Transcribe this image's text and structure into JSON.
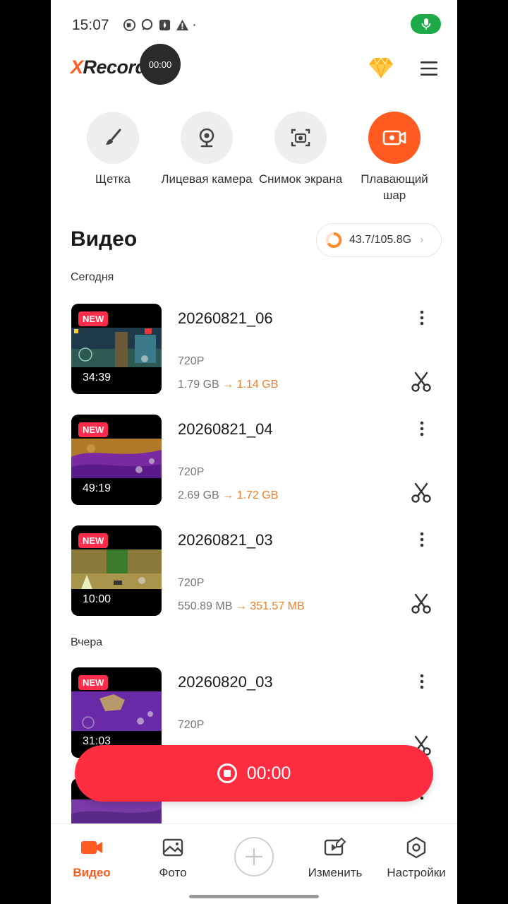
{
  "status": {
    "time": "15:07"
  },
  "header": {
    "logo_x": "X",
    "logo_rest": "Recorder",
    "timer": "00:00"
  },
  "tools": [
    {
      "label": "Щетка",
      "icon": "brush-icon"
    },
    {
      "label": "Лицевая камера",
      "icon": "webcam-icon"
    },
    {
      "label": "Снимок экрана",
      "icon": "screenshot-icon"
    },
    {
      "label": "Плавающий шар",
      "icon": "floating-ball-icon"
    }
  ],
  "videos": {
    "title": "Видео",
    "storage": "43.7/105.8G",
    "groups": [
      {
        "label": "Сегодня"
      },
      {
        "label": "Вчера"
      }
    ],
    "items": [
      {
        "badge": "NEW",
        "name": "20260821_06",
        "duration": "34:39",
        "resolution": "720P",
        "size_from": "1.79 GB",
        "size_to": "1.14 GB"
      },
      {
        "badge": "NEW",
        "name": "20260821_04",
        "duration": "49:19",
        "resolution": "720P",
        "size_from": "2.69 GB",
        "size_to": "1.72 GB"
      },
      {
        "badge": "NEW",
        "name": "20260821_03",
        "duration": "10:00",
        "resolution": "720P",
        "size_from": "550.89 MB",
        "size_to": "351.57 MB"
      },
      {
        "badge": "NEW",
        "name": "20260820_03",
        "duration": "31:03",
        "resolution": "720P",
        "size_from": "",
        "size_to": ""
      }
    ]
  },
  "record": {
    "time": "00:00"
  },
  "nav": [
    {
      "label": "Видео",
      "icon": "video-icon"
    },
    {
      "label": "Фото",
      "icon": "photo-icon"
    },
    {
      "label": "",
      "icon": "plus-icon"
    },
    {
      "label": "Изменить",
      "icon": "edit-video-icon"
    },
    {
      "label": "Настройки",
      "icon": "settings-icon"
    }
  ],
  "colors": {
    "accent": "#ff5a1f",
    "record": "#ff2d3f",
    "badge": "#ff2d4b",
    "size_to": "#ef7d27"
  }
}
